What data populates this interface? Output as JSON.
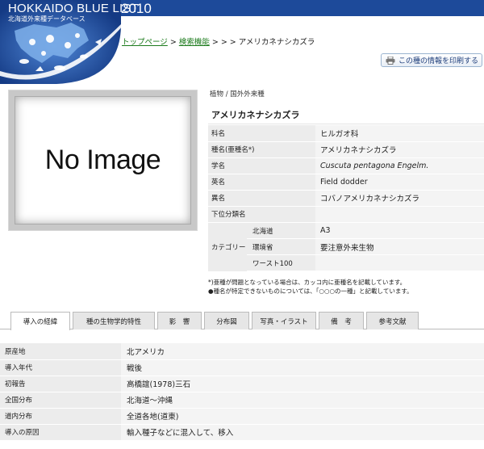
{
  "header": {
    "title": "HOKKAIDO BLUE LIST",
    "subtitle": "北海道外来種データベース",
    "year": "2010",
    "colors": {
      "banner": "#1d4a9a",
      "banner_dark": "#0f2f6e",
      "logo_circle": "#3a6fc0"
    }
  },
  "breadcrumb": {
    "home": "トップページ",
    "search": "検索機能",
    "sep1": " > ",
    "sep2": " > > > ",
    "current": "アメリカネナシカズラ"
  },
  "print_button": {
    "label": "この種の情報を印刷する",
    "icon": "printer-icon"
  },
  "image": {
    "placeholder_text": "No Image"
  },
  "species": {
    "category": "植物 / 国外外来種",
    "name": "アメリカネナシカズラ",
    "fields": [
      {
        "key": "科名",
        "value": "ヒルガオ科",
        "italic": false
      },
      {
        "key": "種名(亜種名*)",
        "value": "アメリカネナシカズラ",
        "italic": false
      },
      {
        "key": "学名",
        "value": "Cuscuta pentagona Engelm.",
        "italic": true
      },
      {
        "key": "英名",
        "value": "Field dodder",
        "italic": false
      },
      {
        "key": "異名",
        "value": "コバノアメリカネナシカズラ",
        "italic": false
      },
      {
        "key": "下位分類名",
        "value": "",
        "italic": false
      }
    ],
    "category_block": {
      "label": "カテゴリー",
      "rows": [
        {
          "key": "北海道",
          "value": "A3"
        },
        {
          "key": "環境省",
          "value": "要注意外来生物"
        },
        {
          "key": "ワースト100",
          "value": ""
        }
      ]
    },
    "notes": [
      "*)亜種が問題となっている場合は、カッコ内に亜種名を記載しています。",
      "●種名が特定できないものについては、「○○○の一種」と記載しています。"
    ]
  },
  "tabs": [
    {
      "label": "導入の経緯",
      "active": true
    },
    {
      "label": "種の生物学的特性",
      "active": false
    },
    {
      "label": "影　響",
      "active": false
    },
    {
      "label": "分布図",
      "active": false
    },
    {
      "label": "写真・イラスト",
      "active": false
    },
    {
      "label": "備　考",
      "active": false
    },
    {
      "label": "参考文献",
      "active": false
    }
  ],
  "details": [
    {
      "key": "原産地",
      "value": "北アメリカ"
    },
    {
      "key": "導入年代",
      "value": "戦後"
    },
    {
      "key": "初報告",
      "value": "高橋誼(1978)三石"
    },
    {
      "key": "全国分布",
      "value": "北海道～沖縄"
    },
    {
      "key": "道内分布",
      "value": "全道各地(道東)"
    },
    {
      "key": "導入の原因",
      "value": "輸入種子などに混入して、移入"
    }
  ]
}
